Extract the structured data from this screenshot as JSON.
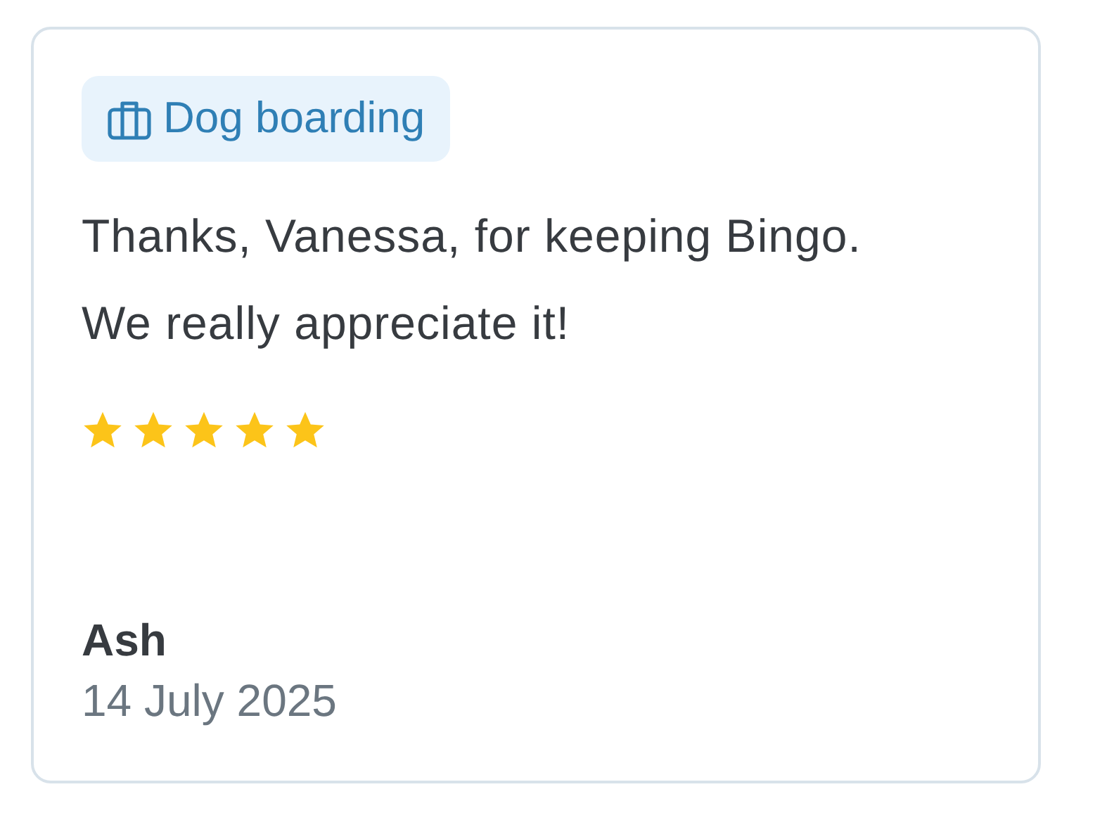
{
  "review": {
    "service": "Dog boarding",
    "text": "Thanks, Vanessa, for keeping Bingo. We really appreciate it!",
    "stars": 5,
    "author": "Ash",
    "date": "14 July 2025"
  }
}
